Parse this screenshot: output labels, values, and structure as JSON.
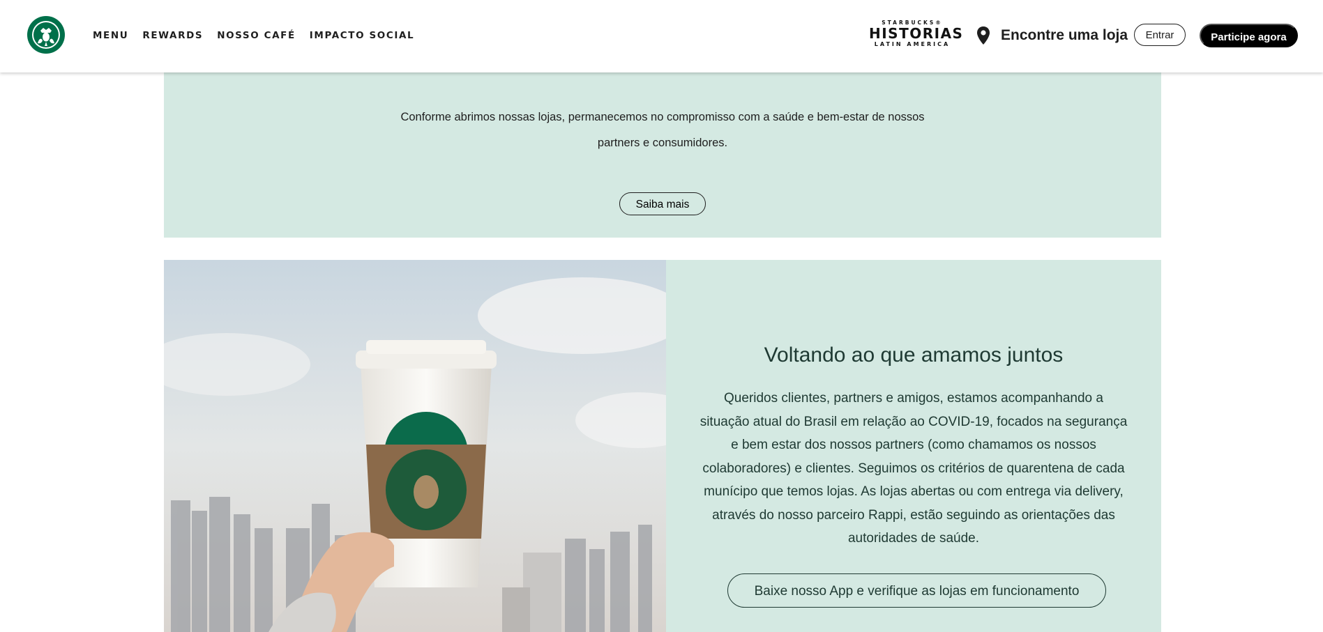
{
  "header": {
    "nav": [
      "MENU",
      "REWARDS",
      "NOSSO CAFÉ",
      "IMPACTO SOCIAL"
    ],
    "historias": {
      "top": "STARBUCKS®",
      "mid": "HISTORIAS",
      "bot": "LATIN AMERICA"
    },
    "store_locator": "Encontre uma loja",
    "signin_label": "Entrar",
    "join_label": "Participe agora"
  },
  "banner": {
    "text_line1": "Conforme abrimos nossas lojas, permanecemos no compromisso com a saúde e bem-estar de nossos",
    "text_line2": "partners e consumidores.",
    "button_label": "Saiba mais"
  },
  "feature": {
    "title": "Voltando ao que amamos juntos",
    "body_lines": [
      "Queridos clientes, partners e amigos, estamos acompanhando a",
      "situação atual do Brasil em relação ao COVID-19, focados na segurança",
      "e bem estar dos nossos partners (como chamamos os nossos",
      "colaboradores) e clientes. Seguimos os critérios de quarentena de cada",
      "munícipo que temos lojas. As lojas abertas ou com entrega via delivery,",
      "através do nosso parceiro Rappi, estão seguindo as orientações das",
      "autoridades de saúde."
    ],
    "button_label": "Baixe nosso App e verifique as lojas em funcionamento"
  },
  "colors": {
    "brand_green": "#00704a",
    "mint": "#d4e9e2",
    "house_green": "#1e3932"
  },
  "icons": [
    "starbucks-siren-logo",
    "location-pin-icon"
  ]
}
